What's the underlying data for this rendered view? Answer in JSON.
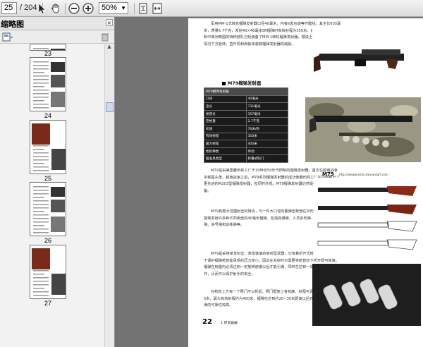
{
  "toolbar": {
    "page_current": "25",
    "page_total": "/ 204",
    "zoom": "50%"
  },
  "sidebar": {
    "title": "缩略图",
    "close_glyph": "×",
    "thumbnails": [
      {
        "page": "23"
      },
      {
        "page": "24"
      },
      {
        "page": "25"
      },
      {
        "page": "26"
      },
      {
        "page": "27"
      }
    ]
  },
  "document": {
    "para_intro": "军用MM-1式转轮榴弹发射器口径40毫米，内有6发右旋等齐膛线，其全长635毫米，质量6.7千克，发射40×46毫米SR榴弹时有效射程为350米。目前美国、墨西哥和中美洲等国的特种部队已经装备了MM-1转轮榴弹发射器，据说土方、炎可在装备情况下方能转、直升机和肩装来装载榴弹发射器的威胁。",
    "section_title": "M79榴弹发射器",
    "spec_header": "M79榴弹发射器",
    "spec_rows": [
      [
        "口径",
        "40毫米"
      ],
      [
        "全长",
        "731毫米"
      ],
      [
        "枪管长",
        "357毫米"
      ],
      [
        "空枪重",
        "2.7千克"
      ],
      [
        "初速",
        "76米/秒"
      ],
      [
        "有效射程",
        "350米"
      ],
      [
        "最大射程",
        "400米"
      ],
      [
        "枪机种类",
        "单动"
      ],
      [
        "瞄准具类型",
        "折叠式照门"
      ]
    ],
    "para_1": "M79是由美国春田兵工厂于20世纪50年代研制的榴弹发射器。首次在越南战争中崭露头角，越南战争之后，M79系列榴弹发射器的成功使春田兵工厂在同期推出了更先进的M203型榴弹发射器，但同时外观，M79榴弹发射器仍然是美军的制式装备。",
    "para_2": "M79有着大范围射击的特点，与一件大口径的霰弹型枪管在外形上十分相似，它能够发射许多种不同用途的40毫米榴弹，包括高爆弹、人员杀伤弹、烟幕弹、照明弹、信号弹和训练弹等。",
    "para_3": "M79是采用单发射击、单发装填的肩射型武器，它有着折开式枪机设计，这是由于保护榴弹枪管能承受的压力较小，因此在发射时只需要将枪管向下折开即可装填，榴弹在枪膛内必须达到一定旋转速度以后才能引爆，同时在达到一定距离以前不会爆炸，从而可以保护射手的安全。",
    "para_4": "在枪管上方有一个照门可以折起，照门框架上有刻度，射程可调整范围为25~375米，最大有效射程约为400米，榴弹在达到约20~30米距离以后开始引爆，使用榴弹的可靠性较高。",
    "m79_label": "M79",
    "m79_url": "http://weaponsho.deviantart.com",
    "footer_page": "22",
    "footer_text": "1  轻武器器"
  },
  "colors": {
    "toolbar_bg": "#e8e8e8",
    "viewer_bg": "#737373",
    "accent_blue": "#2a63c8"
  }
}
